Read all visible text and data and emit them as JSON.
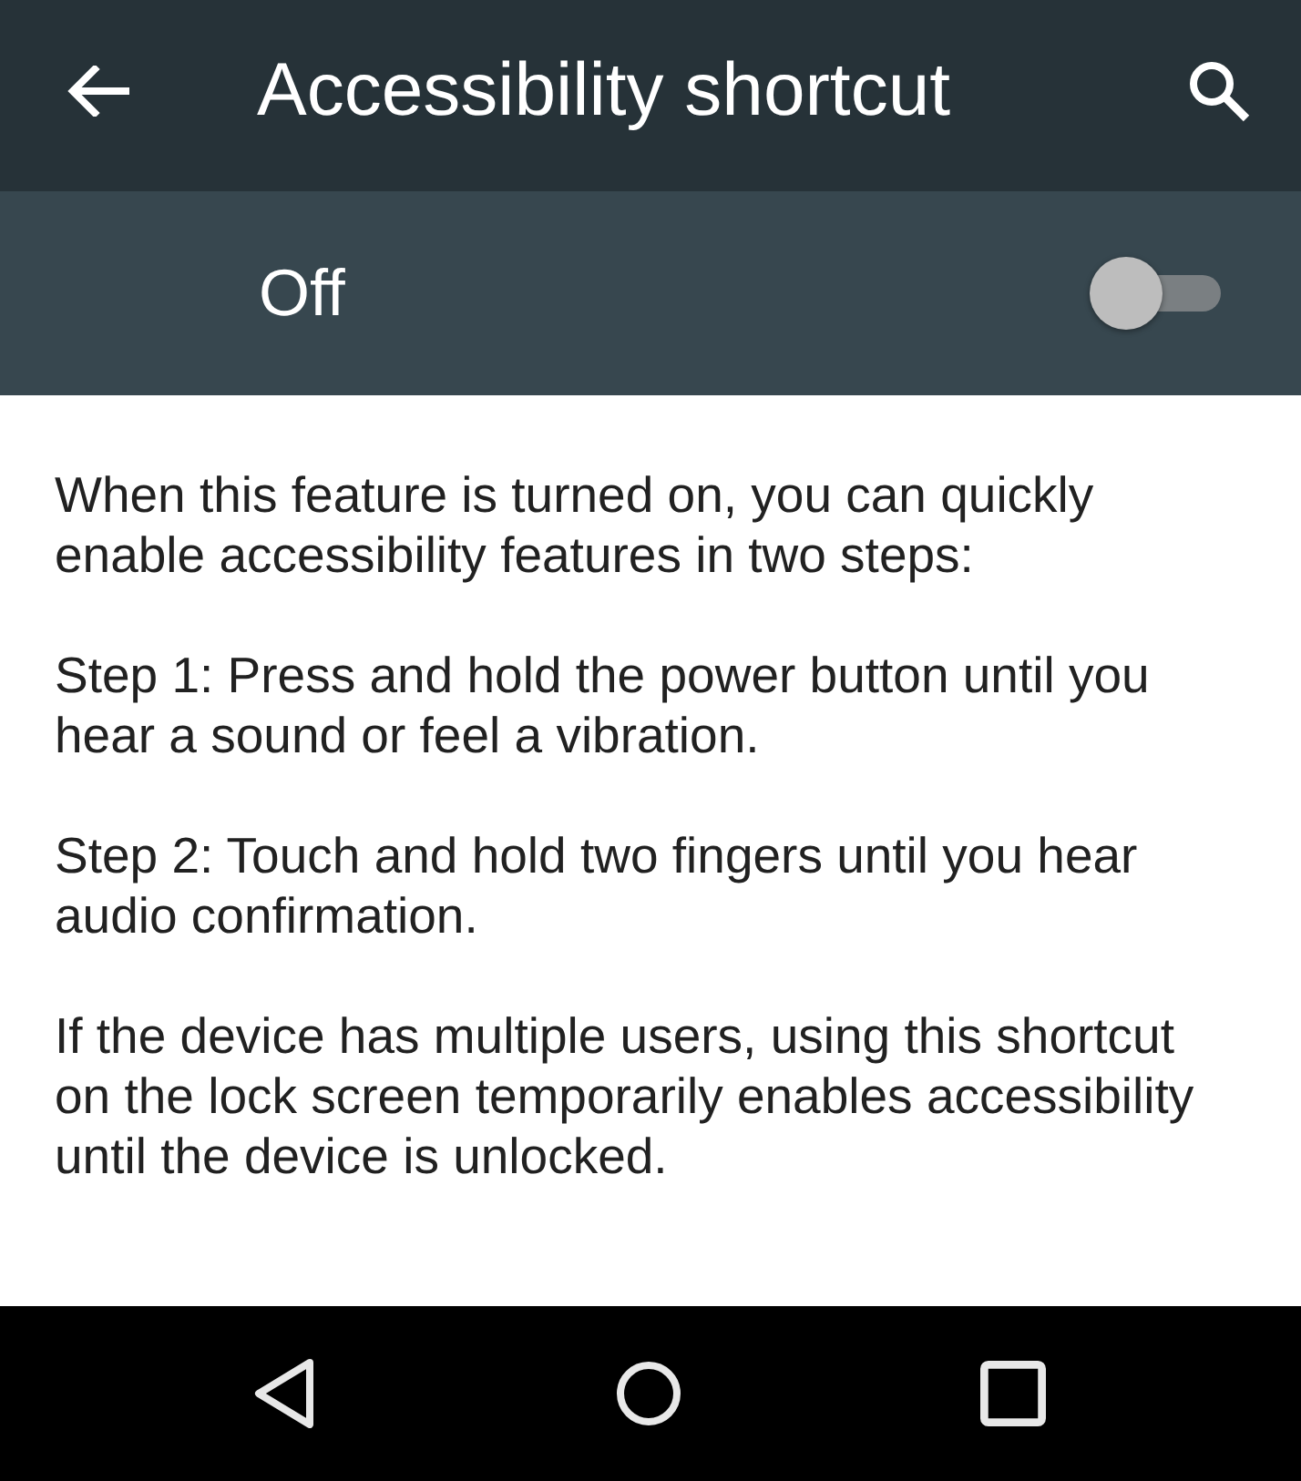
{
  "app_bar": {
    "title": "Accessibility shortcut"
  },
  "master_switch": {
    "label": "Off",
    "on": false
  },
  "description": [
    "When this feature is turned on, you can quickly enable accessibility features in two steps:",
    "Step 1: Press and hold the power button until you hear a sound or feel a vibration.",
    "Step 2: Touch and hold two fingers until you hear audio confirmation.",
    "If the device has multiple users, using this shortcut on the lock screen temporarily enables accessibility until the device is unlocked."
  ]
}
